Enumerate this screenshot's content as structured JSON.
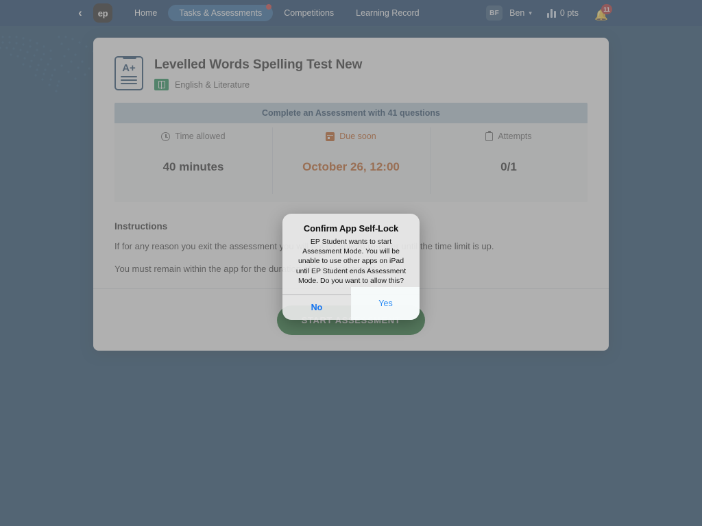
{
  "navbar": {
    "back_icon": "chevron-left-icon",
    "logo_text": "ep",
    "links": [
      {
        "label": "Home",
        "active": false,
        "dot": false
      },
      {
        "label": "Tasks & Assessments",
        "active": true,
        "dot": true
      },
      {
        "label": "Competitions",
        "active": false,
        "dot": false
      },
      {
        "label": "Learning Record",
        "active": false,
        "dot": false
      }
    ],
    "user": {
      "avatar_initials": "BF",
      "name": "Ben",
      "caret": "▾"
    },
    "points": {
      "icon": "bar-chart-icon",
      "label": "0 pts"
    },
    "notifications": {
      "icon": "bell-icon",
      "badge": "11"
    }
  },
  "card": {
    "icon": "assessment-document-icon",
    "icon_grade_text": "A+",
    "title": "Levelled Words Spelling Test New",
    "subject": {
      "icon": "book-icon",
      "name": "English & Literature",
      "color": "#0c8a4a"
    },
    "info_band": "Complete an Assessment with 41 questions",
    "stats": [
      {
        "icon": "clock-icon",
        "label": "Time allowed",
        "value": "40 minutes",
        "highlight": false
      },
      {
        "icon": "calendar-icon",
        "label": "Due soon",
        "value": "October 26, 12:00",
        "highlight": true
      },
      {
        "icon": "clipboard-icon",
        "label": "Attempts",
        "value": "0/1",
        "highlight": false
      }
    ],
    "instructions": {
      "heading": "Instructions",
      "lines": [
        "If for any reason you exit the assessment you will not be able to re-enter until the time limit is up.",
        "You must remain within the app for the duration of the assessment."
      ]
    },
    "start_button": "START ASSESSMENT"
  },
  "alert": {
    "title": "Confirm App Self-Lock",
    "message": "EP Student wants to start Assessment Mode. You will be unable to use other apps on iPad until EP Student ends Assessment Mode. Do you want to allow this?",
    "no_label": "No",
    "yes_label": "Yes"
  },
  "colors": {
    "page_background": "#0b3a61",
    "navbar": "#002f5f",
    "accent_blue": "#1a5c9c",
    "due_orange": "#c3550f",
    "subject_green": "#0c8a4a",
    "start_green": "#0f6b24",
    "badge_red": "#b11f24",
    "alert_link_blue": "#1272f0"
  }
}
